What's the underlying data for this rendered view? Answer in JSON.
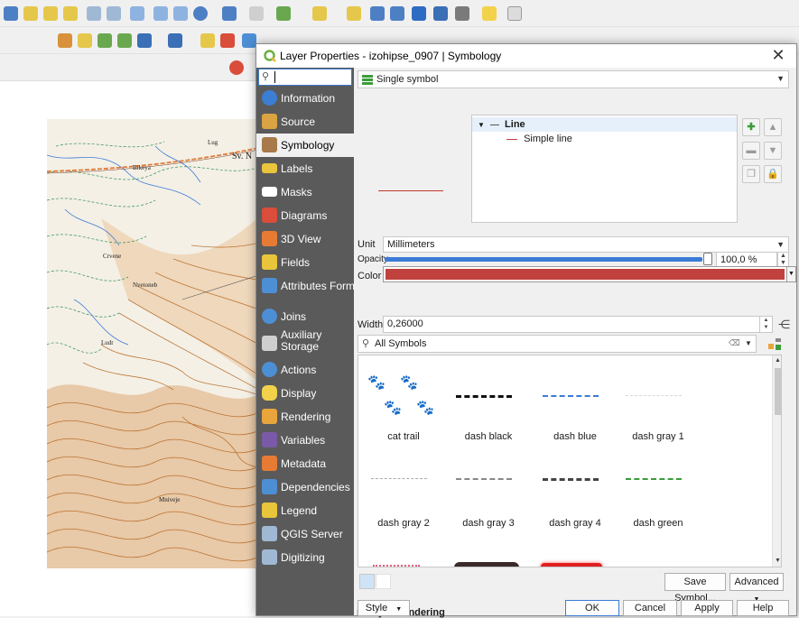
{
  "dialog": {
    "title": "Layer Properties - izohipse_0907 | Symbology",
    "close_glyph": "✕"
  },
  "nav": {
    "search_placeholder": "",
    "items": [
      {
        "label": "Information",
        "icon": "info-icon",
        "color": "#3b7ed4"
      },
      {
        "label": "Source",
        "icon": "source-icon",
        "color": "#d9a441"
      },
      {
        "label": "Symbology",
        "icon": "symbology-icon",
        "color": "#a8794b"
      },
      {
        "label": "Labels",
        "icon": "labels-icon",
        "color": "#e8c53b"
      },
      {
        "label": "Masks",
        "icon": "masks-icon",
        "color": "#ffffff"
      },
      {
        "label": "Diagrams",
        "icon": "diagrams-icon",
        "color": "#d94d3a"
      },
      {
        "label": "3D View",
        "icon": "3d-view-icon",
        "color": "#e77b34"
      },
      {
        "label": "Fields",
        "icon": "fields-icon",
        "color": "#e8c53b"
      },
      {
        "label": "Attributes Form",
        "icon": "attributes-form-icon",
        "color": "#4d8fd4"
      },
      {
        "label": "Joins",
        "icon": "joins-icon",
        "color": "#4d8fd4"
      },
      {
        "label": "Auxiliary Storage",
        "icon": "auxiliary-storage-icon",
        "color": "#cfcfcf"
      },
      {
        "label": "Actions",
        "icon": "actions-icon",
        "color": "#4d8fd4"
      },
      {
        "label": "Display",
        "icon": "display-icon",
        "color": "#f2d24b"
      },
      {
        "label": "Rendering",
        "icon": "rendering-icon",
        "color": "#e8a53b"
      },
      {
        "label": "Variables",
        "icon": "variables-icon",
        "color": "#7a5aa8"
      },
      {
        "label": "Metadata",
        "icon": "metadata-icon",
        "color": "#e77b34"
      },
      {
        "label": "Dependencies",
        "icon": "dependencies-icon",
        "color": "#4d8fd4"
      },
      {
        "label": "Legend",
        "icon": "legend-icon",
        "color": "#e8c53b"
      },
      {
        "label": "QGIS Server",
        "icon": "qgis-server-icon",
        "color": "#9fb8d4"
      },
      {
        "label": "Digitizing",
        "icon": "digitizing-icon",
        "color": "#9fb8d4"
      }
    ]
  },
  "symbology": {
    "renderer": "Single symbol",
    "tree_root": "Line",
    "tree_child": "Simple line",
    "unit_label": "Unit",
    "unit_value": "Millimeters",
    "opacity_label": "Opacity",
    "opacity_value": "100,0 %",
    "opacity_fraction": 1.0,
    "color_label": "Color",
    "color_value": "#c0413e",
    "width_label": "Width",
    "width_value": "0,26000",
    "symbol_search": "All Symbols",
    "symbols": [
      {
        "name": "cat trail",
        "style": "paw"
      },
      {
        "name": "dash  black",
        "style": "dash-black"
      },
      {
        "name": "dash blue",
        "style": "dash-blue"
      },
      {
        "name": "dash gray 1",
        "style": "dash-gray1"
      },
      {
        "name": "dash gray 2",
        "style": "dash-gray2"
      },
      {
        "name": "dash gray 3",
        "style": "dash-gray3"
      },
      {
        "name": "dash gray 4",
        "style": "dash-gray4"
      },
      {
        "name": "dash green",
        "style": "dash-green"
      }
    ],
    "save_symbol": "Save Symbol...",
    "advanced": "Advanced",
    "layer_rendering": "Layer Rendering"
  },
  "buttons": {
    "style": "Style",
    "ok": "OK",
    "cancel": "Cancel",
    "apply": "Apply",
    "help": "Help"
  },
  "map": {
    "labels": [
      "Lug",
      "Sv. N",
      "Bikeya",
      "Nvetoneb",
      "Crvene",
      "Mniveje",
      "Ludr"
    ]
  }
}
